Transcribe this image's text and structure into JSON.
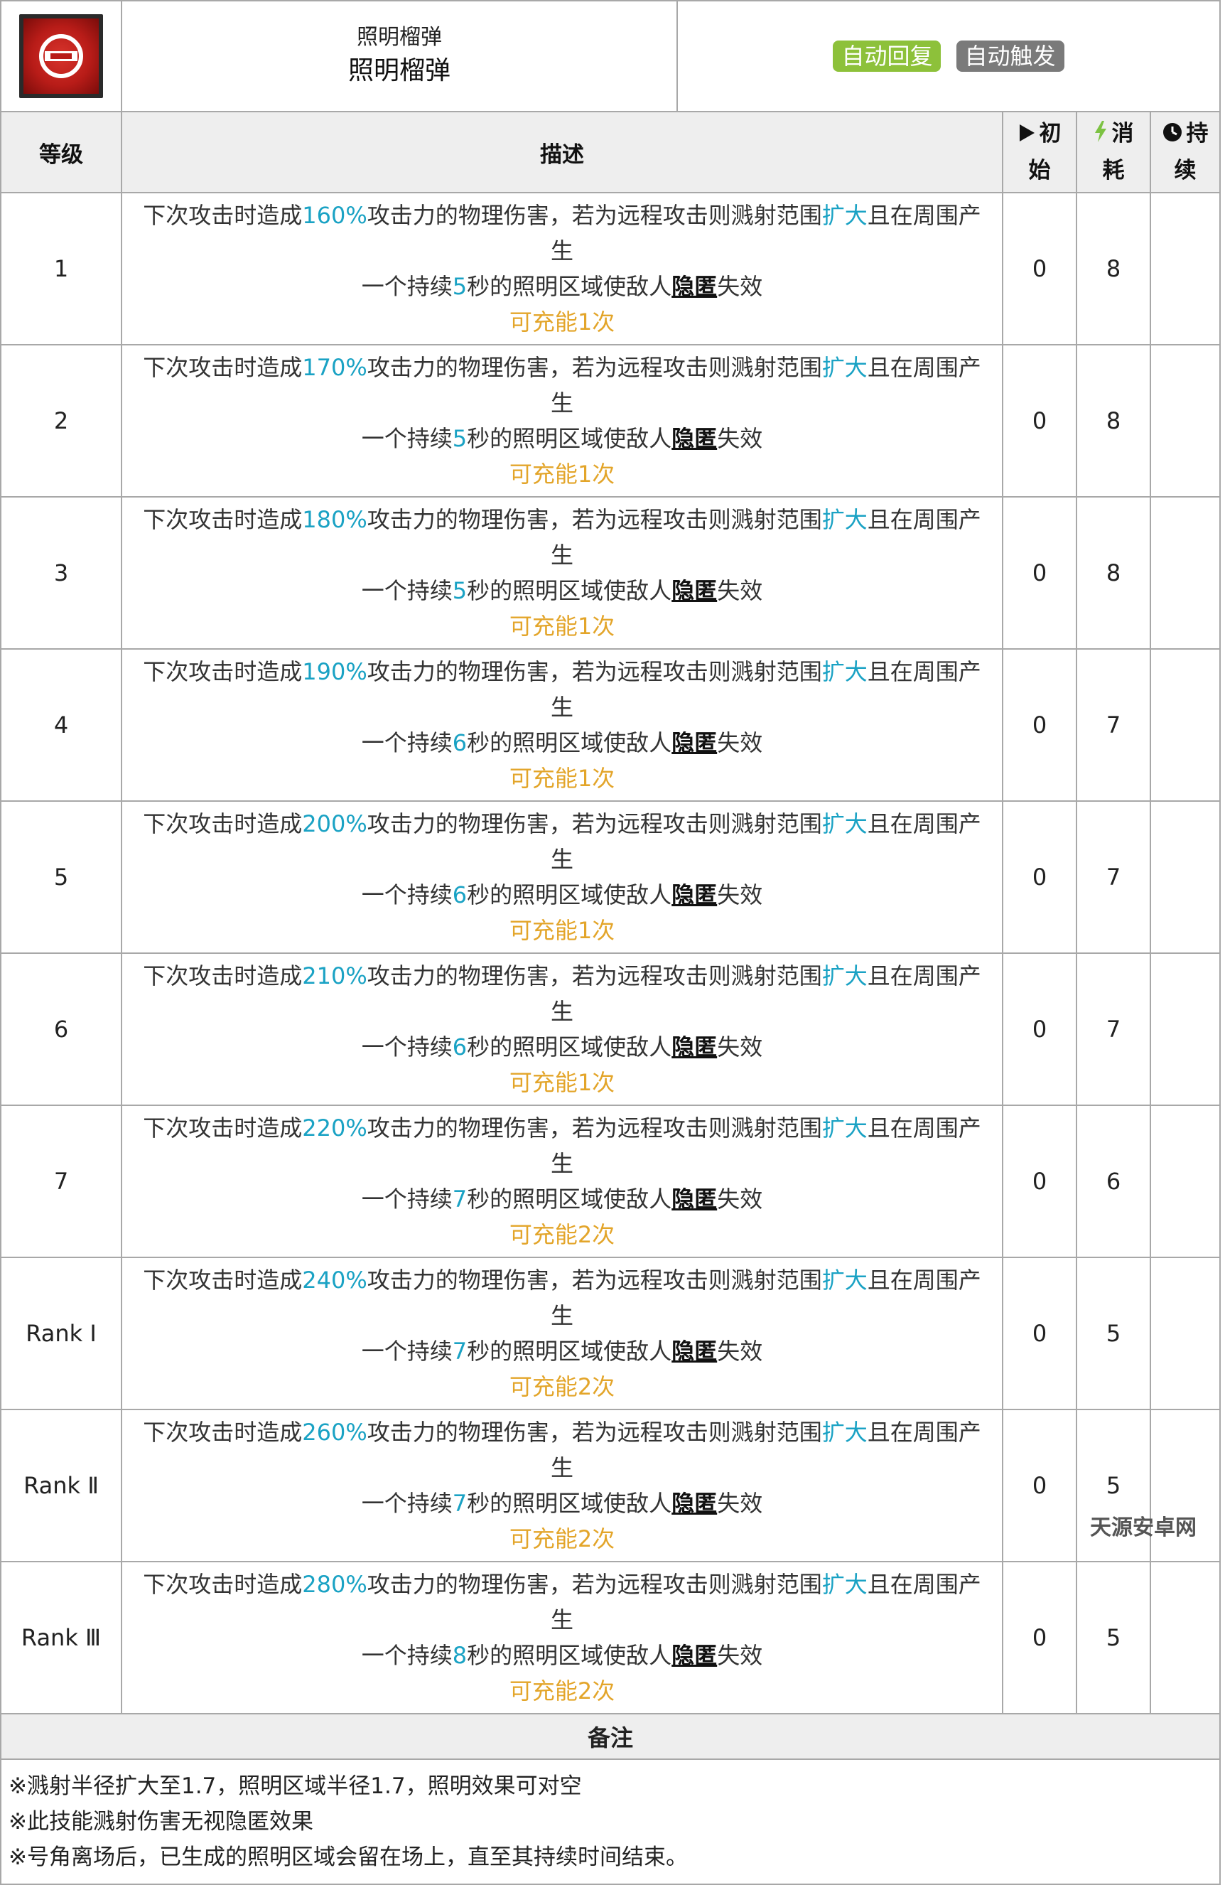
{
  "skill": {
    "subtitle": "照明榴弹",
    "name": "照明榴弹",
    "tags": [
      "自动回复",
      "自动触发"
    ],
    "icon": "flare-grenade-icon"
  },
  "columns": {
    "level": "等级",
    "desc": "描述",
    "initial": [
      "初",
      "始"
    ],
    "cost": [
      "消",
      "耗"
    ],
    "duration": [
      "持",
      "续"
    ]
  },
  "desc_parts": {
    "p1": "下次攻击时造成",
    "p2": "攻击力的物理伤害，若为远程攻击则溅射范围",
    "hl_expand": "扩大",
    "p3": "且在周围产生",
    "p4": "一个持续",
    "p5": "秒的照明区域使敌人",
    "ul_hide": "隐匿",
    "p6": "失效"
  },
  "rows": [
    {
      "level": "1",
      "pct": "160%",
      "secs": "5",
      "charge": "可充能1次",
      "initial": "0",
      "cost": "8",
      "duration": ""
    },
    {
      "level": "2",
      "pct": "170%",
      "secs": "5",
      "charge": "可充能1次",
      "initial": "0",
      "cost": "8",
      "duration": ""
    },
    {
      "level": "3",
      "pct": "180%",
      "secs": "5",
      "charge": "可充能1次",
      "initial": "0",
      "cost": "8",
      "duration": ""
    },
    {
      "level": "4",
      "pct": "190%",
      "secs": "6",
      "charge": "可充能1次",
      "initial": "0",
      "cost": "7",
      "duration": ""
    },
    {
      "level": "5",
      "pct": "200%",
      "secs": "6",
      "charge": "可充能1次",
      "initial": "0",
      "cost": "7",
      "duration": ""
    },
    {
      "level": "6",
      "pct": "210%",
      "secs": "6",
      "charge": "可充能1次",
      "initial": "0",
      "cost": "7",
      "duration": ""
    },
    {
      "level": "7",
      "pct": "220%",
      "secs": "7",
      "charge": "可充能2次",
      "initial": "0",
      "cost": "6",
      "duration": ""
    },
    {
      "level": "Rank Ⅰ",
      "pct": "240%",
      "secs": "7",
      "charge": "可充能2次",
      "initial": "0",
      "cost": "5",
      "duration": ""
    },
    {
      "level": "Rank Ⅱ",
      "pct": "260%",
      "secs": "7",
      "charge": "可充能2次",
      "initial": "0",
      "cost": "5",
      "duration": ""
    },
    {
      "level": "Rank Ⅲ",
      "pct": "280%",
      "secs": "8",
      "charge": "可充能2次",
      "initial": "0",
      "cost": "5",
      "duration": ""
    }
  ],
  "notes_title": "备注",
  "notes": [
    "※溅射半径扩大至1.7，照明区域半径1.7，照明效果可对空",
    "※此技能溅射伤害无视隐匿效果",
    "※号角离场后，已生成的照明区域会留在场上，直至其持续时间结束。"
  ],
  "watermark": "天源安卓网",
  "colors": {
    "highlight": "#1aa2c4",
    "charge": "#e3a52a",
    "tag_green": "#8dc13a",
    "tag_grey": "#7a7a7a"
  }
}
